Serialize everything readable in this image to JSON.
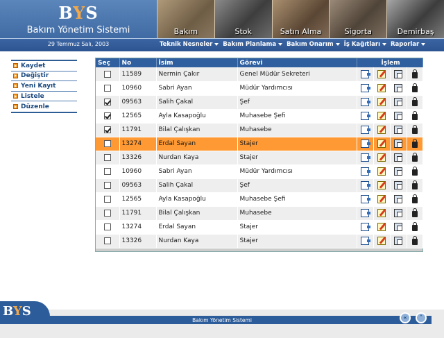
{
  "header": {
    "logo_prefix": "B",
    "logo_accent": "Y",
    "logo_suffix": "S",
    "app_name": "Bakım Yönetim Sistemi",
    "date": "29 Temmuz Salı, 2003",
    "modules": [
      "Bakım",
      "Stok",
      "Satın Alma",
      "Sigorta",
      "Demirbaş"
    ],
    "menu": [
      "Teknik Nesneler",
      "Bakım Planlama",
      "Bakım Onarım",
      "İş Kağıtları",
      "Raporlar"
    ]
  },
  "sidebar": {
    "items": [
      "Kaydet",
      "Değiştir",
      "Yeni Kayıt",
      "Listele",
      "Düzenle"
    ]
  },
  "table": {
    "headers": {
      "sec": "Seç",
      "no": "No",
      "isim": "İsim",
      "gorevi": "Görevi",
      "islem": "İşlem"
    },
    "rows": [
      {
        "checked": false,
        "no": "11589",
        "name": "Nermin Çakır",
        "role": "Genel Müdür Sekreteri"
      },
      {
        "checked": false,
        "no": "10960",
        "name": "Sabri Ayan",
        "role": "Müdür Yardımcısı"
      },
      {
        "checked": true,
        "no": "09563",
        "name": "Salih Çakal",
        "role": "Şef"
      },
      {
        "checked": true,
        "no": "12565",
        "name": "Ayla Kasapoğlu",
        "role": "Muhasebe Şefi"
      },
      {
        "checked": true,
        "no": "11791",
        "name": "Bilal Çalışkan",
        "role": "Muhasebe"
      },
      {
        "checked": false,
        "no": "13274",
        "name": "Erdal Sayan",
        "role": "Stajer",
        "highlighted": true
      },
      {
        "checked": false,
        "no": "13326",
        "name": "Nurdan Kaya",
        "role": "Stajer"
      },
      {
        "checked": false,
        "no": "10960",
        "name": "Sabri Ayan",
        "role": "Müdür Yardımcısı"
      },
      {
        "checked": false,
        "no": "09563",
        "name": "Salih Çakal",
        "role": "Şef"
      },
      {
        "checked": false,
        "no": "12565",
        "name": "Ayla Kasapoğlu",
        "role": "Muhasebe Şefi"
      },
      {
        "checked": false,
        "no": "11791",
        "name": "Bilal Çalışkan",
        "role": "Muhasebe"
      },
      {
        "checked": false,
        "no": "13274",
        "name": "Erdal Sayan",
        "role": "Stajer"
      },
      {
        "checked": false,
        "no": "13326",
        "name": "Nurdan Kaya",
        "role": "Stajer"
      }
    ],
    "action_icons": [
      "document-icon",
      "edit-icon",
      "copy-icon",
      "lock-icon"
    ]
  },
  "footer": {
    "logo_prefix": "B",
    "logo_accent": "Y",
    "logo_suffix": "S",
    "text": "Bakım Yönetim Sistemi"
  },
  "colors": {
    "primary": "#2f5f9f",
    "highlight": "#ff9933",
    "accent": "#f39a2b"
  }
}
